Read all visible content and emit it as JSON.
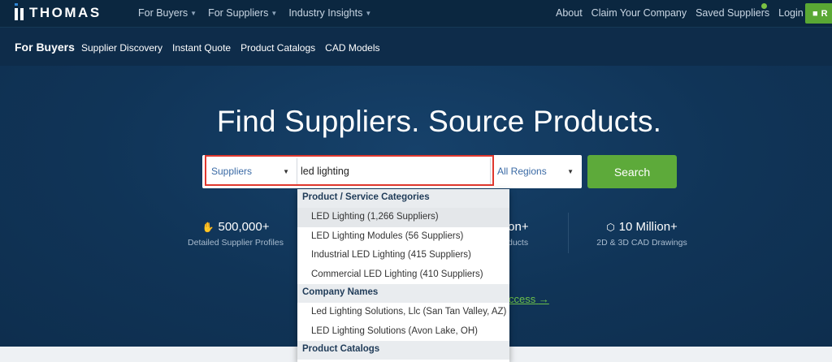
{
  "brand": {
    "name": "THOMAS"
  },
  "topnav": {
    "left": [
      {
        "label": "For Buyers"
      },
      {
        "label": "For Suppliers"
      },
      {
        "label": "Industry Insights"
      }
    ],
    "right": [
      {
        "label": "About"
      },
      {
        "label": "Claim Your Company"
      },
      {
        "label": "Saved Suppliers"
      },
      {
        "label": "Login"
      }
    ],
    "register_label": "R"
  },
  "subnav": {
    "title": "For Buyers",
    "links": [
      "Supplier Discovery",
      "Instant Quote",
      "Product Catalogs",
      "CAD Models"
    ]
  },
  "hero": {
    "headline": "Find Suppliers. Source Products."
  },
  "search": {
    "scope": "Suppliers",
    "query": "led lighting",
    "region": "All Regions",
    "button_label": "Search"
  },
  "stats": [
    {
      "value": "500,000+",
      "label": "Detailed Supplier Profiles",
      "icon": "handshake-icon"
    },
    {
      "value": "Million+",
      "label": "d Products",
      "icon": ""
    },
    {
      "value": "10 Million+",
      "label": "2D & 3D CAD Drawings",
      "icon": "cube-icon"
    }
  ],
  "access_link": "ccess",
  "suggestions": {
    "sections": [
      {
        "title": "Product / Service Categories",
        "items": [
          "LED Lighting (1,266 Suppliers)",
          "LED Lighting Modules (56 Suppliers)",
          "Industrial LED Lighting (415 Suppliers)",
          "Commercial LED Lighting (410 Suppliers)"
        ]
      },
      {
        "title": "Company Names",
        "items": [
          "Led Lighting Solutions, Llc (San Tan Valley, AZ)",
          "LED Lighting Solutions (Avon Lake, OH)"
        ]
      },
      {
        "title": "Product Catalogs",
        "items": []
      }
    ]
  },
  "colors": {
    "nav_bg": "#0b2740",
    "hero_bg": "#103457",
    "accent_green": "#5daa3a",
    "highlight_red": "#e0382e"
  }
}
